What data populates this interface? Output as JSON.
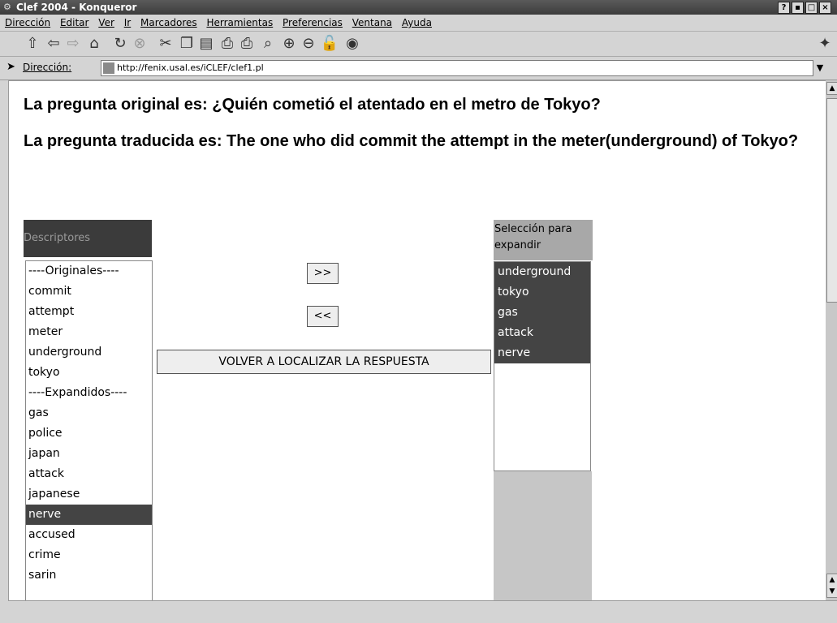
{
  "window": {
    "title": "Clef 2004 - Konqueror",
    "buttons": [
      "?",
      "▪",
      "□",
      "×"
    ]
  },
  "menu": [
    "Dirección",
    "Editar",
    "Ver",
    "Ir",
    "Marcadores",
    "Herramientas",
    "Preferencias",
    "Ventana",
    "Ayuda"
  ],
  "address": {
    "label": "Dirección:",
    "url": "http://fenix.usal.es/iCLEF/clef1.pl"
  },
  "page": {
    "original_question": "La pregunta original es: ¿Quién cometió el atentado en el metro de Tokyo?",
    "translated_question": "La pregunta traducida es: The one who did commit the attempt in the meter(underground) of Tokyo?",
    "descriptors_header": "Descriptores",
    "descriptors": [
      {
        "label": "----Originales----",
        "selected": false
      },
      {
        "label": "commit",
        "selected": false
      },
      {
        "label": "attempt",
        "selected": false
      },
      {
        "label": "meter",
        "selected": false
      },
      {
        "label": "underground",
        "selected": false
      },
      {
        "label": "tokyo",
        "selected": false
      },
      {
        "label": "----Expandidos----",
        "selected": false
      },
      {
        "label": "gas",
        "selected": false
      },
      {
        "label": "police",
        "selected": false
      },
      {
        "label": "japan",
        "selected": false
      },
      {
        "label": "attack",
        "selected": false
      },
      {
        "label": "japanese",
        "selected": false
      },
      {
        "label": "nerve",
        "selected": true
      },
      {
        "label": "accused",
        "selected": false
      },
      {
        "label": "crime",
        "selected": false
      },
      {
        "label": "sarin",
        "selected": false
      }
    ],
    "add_button": ">>",
    "remove_button": "<<",
    "relocate_button": "VOLVER A LOCALIZAR LA RESPUESTA",
    "selection_header": "Selección para expandir",
    "selection": [
      "underground",
      "tokyo",
      "gas",
      "attack",
      "nerve"
    ]
  },
  "colors": {
    "titlebar": "#4a4a4a",
    "selected": "#444444",
    "chrome": "#d4d4d4"
  }
}
